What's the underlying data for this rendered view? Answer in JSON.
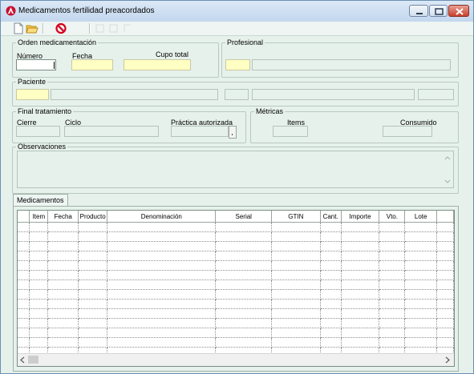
{
  "window": {
    "title": "Medicamentos fertilidad preacordados",
    "controls": [
      "minimize",
      "maximize",
      "close"
    ]
  },
  "toolbar": {
    "icons": [
      "new-document-icon",
      "open-folder-icon",
      "cancel-icon",
      "disabled-tool-icon",
      "disabled-tool-icon",
      "disabled-tool-icon"
    ]
  },
  "orden": {
    "legend": "Orden medicamentación",
    "numero_label": "Número",
    "fecha_label": "Fecha",
    "cupo_label": "Cupo total",
    "numero_value": "",
    "fecha_value": "",
    "cupo_value": ""
  },
  "profesional": {
    "legend": "Profesional",
    "code": "",
    "name": ""
  },
  "paciente": {
    "legend": "Paciente",
    "code": "",
    "name": ""
  },
  "final": {
    "legend": "Final tratamiento",
    "cierre_label": "Cierre",
    "ciclo_label": "Ciclo",
    "practica_label": "Práctica autorizada"
  },
  "metricas": {
    "legend": "Métricas",
    "items_label": "Items",
    "consumido_label": "Consumido"
  },
  "observaciones": {
    "legend": "Observaciones",
    "value": ""
  },
  "tabs": [
    {
      "label": "Medicamentos",
      "active": true
    }
  ],
  "grid": {
    "columns": [
      "",
      "Item",
      "Fecha",
      "Producto",
      "Denominación",
      "Serial",
      "GTIN",
      "Cant.",
      "Importe",
      "Vto.",
      "Lote",
      ""
    ],
    "row_count": 15
  },
  "colors": {
    "required_field": "#ffffc4",
    "background": "#e6f1ec"
  }
}
